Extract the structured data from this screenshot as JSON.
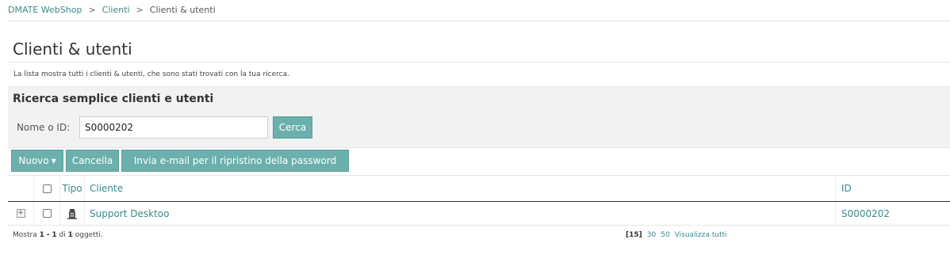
{
  "breadcrumb": {
    "items": [
      "DMATE WebShop",
      "Clienti",
      "Clienti & utenti"
    ],
    "separator": ">"
  },
  "page": {
    "title": "Clienti & utenti",
    "description": "La lista mostra tutti i clienti & utenti, che sono stati trovati con la tua ricerca."
  },
  "search": {
    "heading": "Ricerca semplice clienti e utenti",
    "label": "Nome o ID:",
    "value": "S0000202",
    "button": "Cerca"
  },
  "toolbar": {
    "new_label": "Nuovo",
    "delete_label": "Cancella",
    "reset_label": "Invia e-mail per il ripristino della password"
  },
  "table": {
    "columns": {
      "type": "Tipo",
      "client": "Cliente",
      "id": "ID"
    },
    "rows": [
      {
        "type_icon": "building-icon",
        "client": "Support Desktoo",
        "id": "S0000202"
      }
    ]
  },
  "footer": {
    "prefix": "Mostra",
    "from": "1",
    "dash": "-",
    "to": "1",
    "of": "di",
    "total": "1",
    "suffix": "oggetti."
  },
  "pager": {
    "current": "[15]",
    "options": [
      "30",
      "50"
    ],
    "all": "Visualizza tutti"
  },
  "colors": {
    "accent": "#6bb0ac",
    "link": "#3a8a8a",
    "panel_bg": "#f2f2f2"
  }
}
